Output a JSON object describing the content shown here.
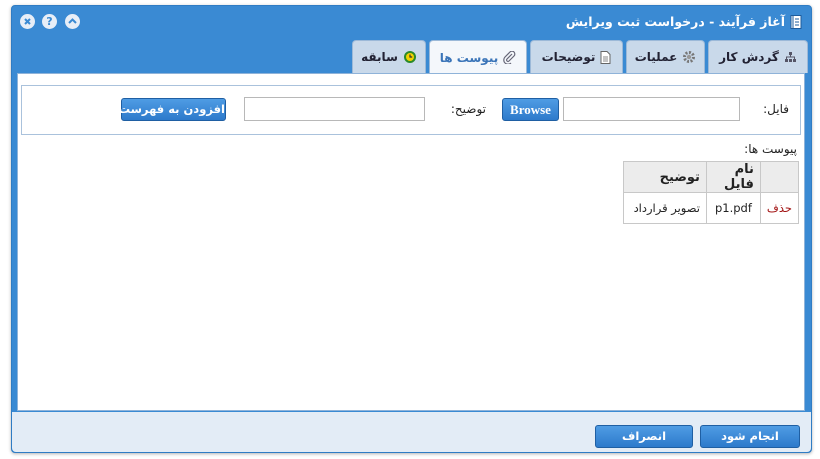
{
  "window": {
    "title": "آغاز فرآیند - درخواست ثبت ویرایش",
    "buttons": [
      "collapse",
      "help",
      "close"
    ]
  },
  "tabs": [
    {
      "label": "گردش کار",
      "icon": "workflow-icon",
      "active": false
    },
    {
      "label": "عملیات",
      "icon": "gear-icon",
      "active": false
    },
    {
      "label": "توضیحات",
      "icon": "document-icon",
      "active": false
    },
    {
      "label": "پیوست ها",
      "icon": "paperclip-icon",
      "active": true
    },
    {
      "label": "سابقه",
      "icon": "history-icon",
      "active": false
    }
  ],
  "form": {
    "file_label": "فایل:",
    "file_value": "",
    "browse_label": "Browse",
    "description_label": "توضیح:",
    "description_value": "",
    "add_to_list_label": "افزودن به فهرست"
  },
  "attachments": {
    "section_label": "پیوست ها:",
    "columns": [
      "",
      "نام فایل",
      "توضیح"
    ],
    "rows": [
      {
        "action": "حذف",
        "file_name": "p1.pdf",
        "description": "تصویر قرارداد"
      }
    ]
  },
  "footer": {
    "submit_label": "انجام شود",
    "cancel_label": "انصراف"
  },
  "colors": {
    "window_blue": "#3a8ad3",
    "tab_inactive": "#c9d9ea",
    "tab_active_text": "#3a74b8",
    "delete_link": "#a31515"
  }
}
